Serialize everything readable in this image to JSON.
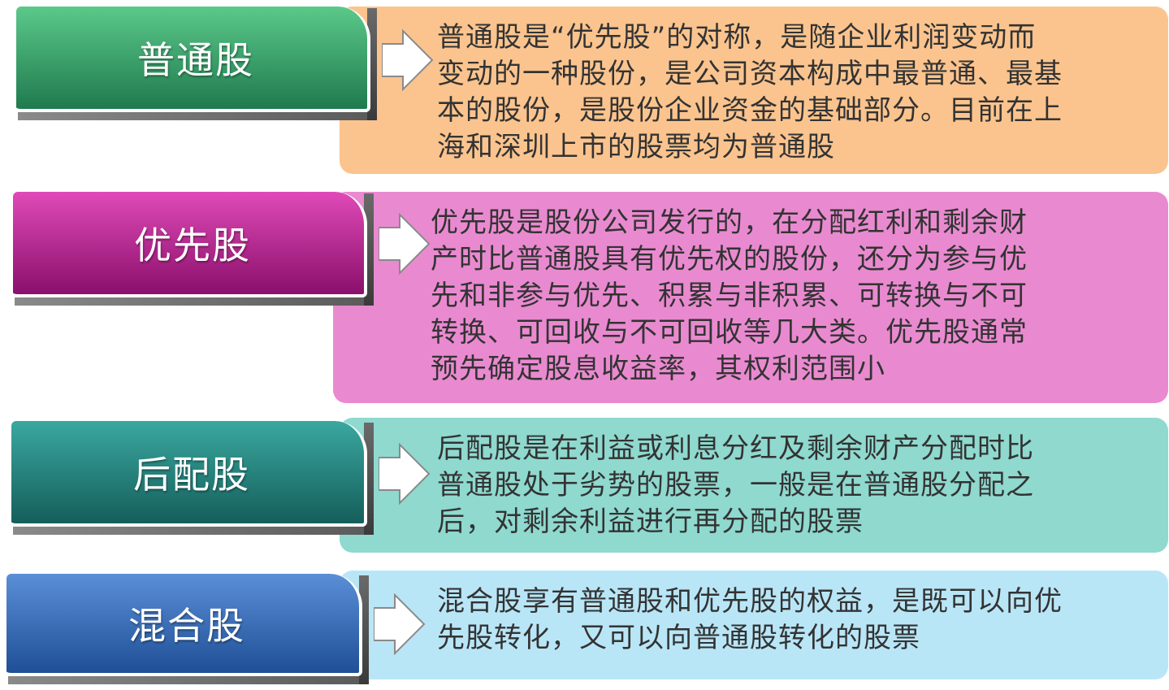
{
  "items": [
    {
      "label": "普通股",
      "lines": [
        "普通股是“优先股”的对称，是随企业利润变动而",
        "变动的一种股份，是公司资本构成中最普通、最基",
        "本的股份，是股份企业资金的基础部分。目前在上",
        "海和深圳上市的股票均为普通股"
      ],
      "label_colors": [
        "#5bc98a",
        "#1f7a4e"
      ],
      "desc_color": "#fbc48e"
    },
    {
      "label": "优先股",
      "lines": [
        "优先股是股份公司发行的，在分配红利和剩余财",
        "产时比普通股具有优先权的股份，还分为参与优",
        "先和非参与优先、积累与非积累、可转换与不可",
        "转换、可回收与不可回收等几大类。优先股通常",
        "预先确定股息收益率，其权利范围小"
      ],
      "label_colors": [
        "#e04ab8",
        "#8a0f6b"
      ],
      "desc_color": "#e98ad0"
    },
    {
      "label": "后配股",
      "lines": [
        "后配股是在利益或利息分红及剩余财产分配时比",
        "普通股处于劣势的股票，一般是在普通股分配之",
        "后，对剩余利益进行再分配的股票"
      ],
      "label_colors": [
        "#3aa8a0",
        "#155e5a"
      ],
      "desc_color": "#8fd9cf"
    },
    {
      "label": "混合股",
      "lines": [
        "混合股享有普通股和优先股的权益，是既可以向优",
        "先股转化，又可以向普通股转化的股票"
      ],
      "label_colors": [
        "#5a8fd8",
        "#1f4f96"
      ],
      "desc_color": "#b9e6f7"
    }
  ]
}
